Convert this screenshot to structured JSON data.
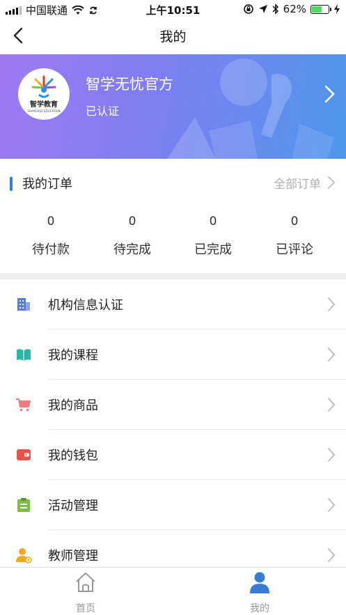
{
  "status_bar": {
    "carrier": "中国联通",
    "time": "上午10:51",
    "battery": "62%",
    "battery_level": 0.62
  },
  "nav": {
    "title": "我的"
  },
  "profile": {
    "org_name": "智学无忧官方",
    "status": "已认证",
    "logo_text": "智学教育",
    "logo_subtext": "SHANGXUE EDUCATION"
  },
  "orders": {
    "title": "我的订单",
    "all_label": "全部订单",
    "accent": "#3a7bd5",
    "stats": [
      {
        "count": "0",
        "label": "待付款"
      },
      {
        "count": "0",
        "label": "待完成"
      },
      {
        "count": "0",
        "label": "已完成"
      },
      {
        "count": "0",
        "label": "已评论"
      }
    ]
  },
  "menu": {
    "items": [
      {
        "label": "机构信息认证",
        "icon": "building-icon",
        "color": "#5b7de0"
      },
      {
        "label": "我的课程",
        "icon": "book-icon",
        "color": "#2bb5a8"
      },
      {
        "label": "我的商品",
        "icon": "cart-icon",
        "color": "#f07a7a"
      },
      {
        "label": "我的钱包",
        "icon": "wallet-icon",
        "color": "#e5534b"
      },
      {
        "label": "活动管理",
        "icon": "clipboard-icon",
        "color": "#7bc043"
      },
      {
        "label": "教师管理",
        "icon": "teacher-icon",
        "color": "#f5a623"
      }
    ]
  },
  "tabs": {
    "home_label": "首页",
    "mine_label": "我的",
    "active_color": "#3a7bd5",
    "inactive_color": "#999999"
  }
}
